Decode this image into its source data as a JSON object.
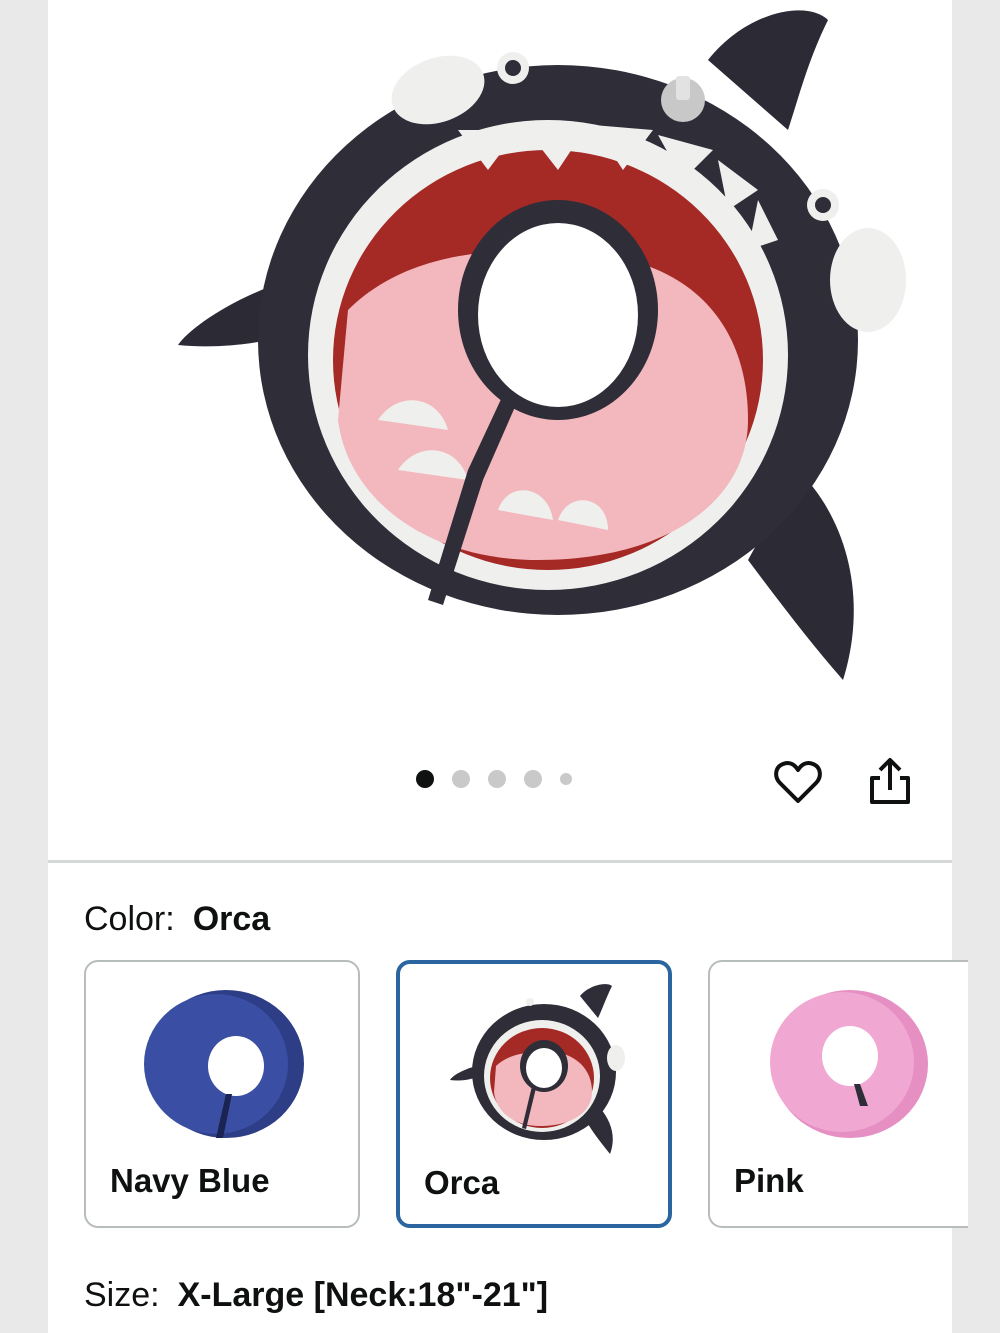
{
  "product": {
    "image_icon": "orca-cone-collar-image",
    "carousel": {
      "total": 5,
      "active": 1
    }
  },
  "actions": {
    "favorite_icon": "heart-icon",
    "share_icon": "share-icon"
  },
  "color": {
    "label": "Color:",
    "selected": "Orca",
    "options": [
      {
        "name": "Navy Blue",
        "color": "#2d3d86"
      },
      {
        "name": "Orca",
        "color": "#2e2d38"
      },
      {
        "name": "Pink",
        "color": "#f0a8d3"
      }
    ]
  },
  "size": {
    "label": "Size:",
    "selected": "X-Large [Neck:18\"-21\"]"
  },
  "colors": {
    "selected_border": "#2a65a0",
    "divider": "#d5d9d9"
  }
}
